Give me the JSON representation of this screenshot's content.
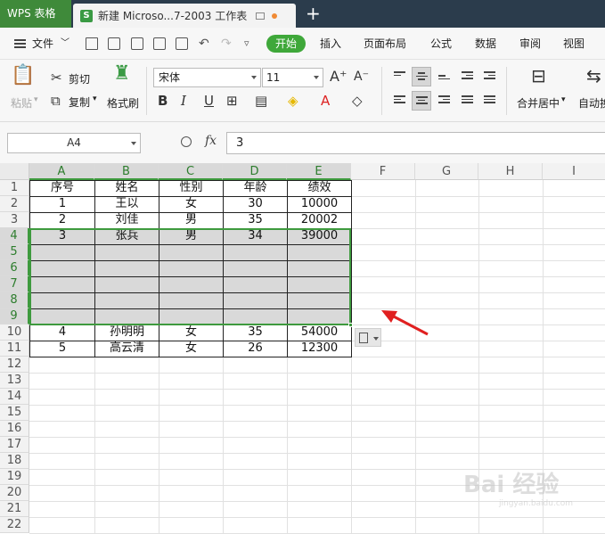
{
  "titlebar": {
    "app_name": "WPS 表格",
    "doc_tab_icon": "S",
    "doc_title": "新建 Microso...7-2003 工作表",
    "new_tab": "+"
  },
  "menubar": {
    "file": "文件",
    "tabs": [
      "开始",
      "插入",
      "页面布局",
      "公式",
      "数据",
      "审阅",
      "视图"
    ],
    "active_tab": "开始"
  },
  "ribbon": {
    "paste": "粘贴",
    "cut": "剪切",
    "copy": "复制",
    "format_painter": "格式刷",
    "font_name": "宋体",
    "font_size": "11",
    "bold": "B",
    "italic": "I",
    "underline": "U",
    "merge_center": "合并居中",
    "auto_wrap": "自动换"
  },
  "formula_bar": {
    "cell_ref": "A4",
    "fx_label": "fx",
    "value": "3"
  },
  "sheet": {
    "columns": [
      "A",
      "B",
      "C",
      "D",
      "E",
      "F",
      "G",
      "H",
      "I"
    ],
    "rows": [
      "1",
      "2",
      "3",
      "4",
      "5",
      "6",
      "7",
      "8",
      "9",
      "10",
      "11",
      "12",
      "13",
      "14",
      "15",
      "16",
      "17",
      "18",
      "19",
      "20",
      "21",
      "22"
    ],
    "header": [
      "序号",
      "姓名",
      "性别",
      "年龄",
      "绩效"
    ],
    "data": [
      [
        "1",
        "王以",
        "女",
        "30",
        "10000"
      ],
      [
        "2",
        "刘佳",
        "男",
        "35",
        "20002"
      ],
      [
        "3",
        "张兵",
        "男",
        "34",
        "39000"
      ],
      [
        "",
        "",
        "",
        "",
        ""
      ],
      [
        "",
        "",
        "",
        "",
        ""
      ],
      [
        "",
        "",
        "",
        "",
        ""
      ],
      [
        "",
        "",
        "",
        "",
        ""
      ],
      [
        "",
        "",
        "",
        "",
        ""
      ],
      [
        "4",
        "孙明明",
        "女",
        "35",
        "54000"
      ],
      [
        "5",
        "高云清",
        "女",
        "26",
        "12300"
      ]
    ],
    "selected_range": "A4:E9"
  },
  "colors": {
    "accent_green": "#3fa83a",
    "selection_border": "#3e9a3e",
    "arrow": "#e02020"
  },
  "watermark": {
    "text": "Bai 经验",
    "sub": "jingyan.baidu.com"
  }
}
